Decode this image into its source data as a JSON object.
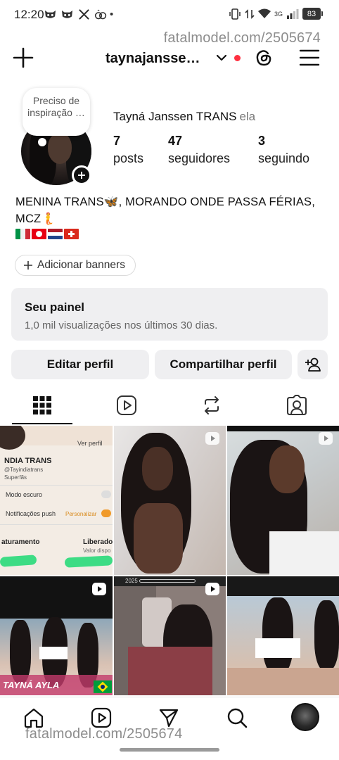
{
  "status_bar": {
    "time": "12:20",
    "dot": "•",
    "battery": "83",
    "network": "3G"
  },
  "watermark": {
    "top": "fatalmodel.com/2505674",
    "bottom": "fatalmodel.com/2505674"
  },
  "header": {
    "username": "taynajansse…",
    "icons": [
      "plus-icon",
      "chevron-down-icon",
      "threads-icon",
      "menu-icon"
    ],
    "notification_dot_color": "#ff3040"
  },
  "profile": {
    "note": "Preciso de inspiração …",
    "display_name": "Tayná Janssen TRANS",
    "pronoun": "ela",
    "stats": [
      {
        "num": "7",
        "label": "posts"
      },
      {
        "num": "47",
        "label": "seguidores"
      },
      {
        "num": "3",
        "label": "seguindo"
      }
    ],
    "bio": "MENINA TRANS🦋, MORANDO ONDE PASSA FÉRIAS, MCZ🧜",
    "flags": [
      "italy-flag",
      "tunisia-flag",
      "netherlands-flag",
      "switzerland-flag"
    ],
    "banners_button": "Adicionar banners"
  },
  "dashboard": {
    "title": "Seu painel",
    "subtitle": "1,0 mil visualizações nos últimos 30 dias."
  },
  "actions": {
    "edit": "Editar perfil",
    "share": "Compartilhar perfil"
  },
  "tabs": [
    "grid-icon",
    "reels-icon",
    "reposts-icon",
    "tagged-icon"
  ],
  "grid": {
    "post1": {
      "link": "Ver perfil",
      "name": "NDIA TRANS",
      "handle": "@Tayindiatrans",
      "sub": "Superfãs",
      "row1": "Modo escuro",
      "row2": "Notificações push",
      "personalize": "Personalizar",
      "left_label": "aturamento",
      "right_label": "Liberado",
      "right_sub": "Valor dispo"
    },
    "post4_text": "TAYNÁ AYLA",
    "post5_text": "2025"
  },
  "nav": [
    "home-icon",
    "reels-icon",
    "share-icon",
    "search-icon",
    "profile-avatar"
  ]
}
